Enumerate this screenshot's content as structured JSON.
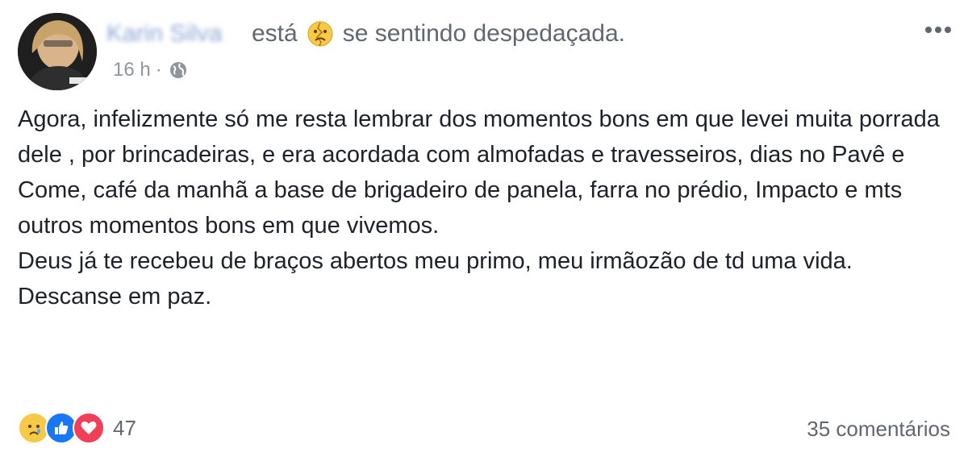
{
  "post": {
    "author_name": "Karin Silva",
    "verb": "está",
    "feeling_text": "se sentindo despedaçada.",
    "timestamp": "16 h",
    "separator": "·",
    "privacy_icon": "globe-icon",
    "feeling_icon": "broken-face-emoji",
    "more_icon": "more-options-icon",
    "paragraphs": [
      "Agora, infelizmente só me resta lembrar dos momentos bons em que levei muita porrada dele , por brincadeiras, e era acordada com almofadas e travesseiros, dias no Pavê e Come, café da manhã a base de brigadeiro de panela, farra no prédio, Impacto e mts outros momentos bons em que vivemos.",
      "Deus já te recebeu de braços abertos meu primo, meu irmãozão de td uma vida.",
      "Descanse em paz."
    ]
  },
  "footer": {
    "reaction_icons": [
      "sad-reaction-icon",
      "like-reaction-icon",
      "love-reaction-icon"
    ],
    "reaction_count": "47",
    "comments_label": "35 comentários"
  },
  "colors": {
    "like_blue": "#1877f2",
    "love_red": "#f33e58",
    "emoji_yellow": "#f7c948",
    "text_primary": "#1d2129",
    "text_secondary": "#606770"
  }
}
